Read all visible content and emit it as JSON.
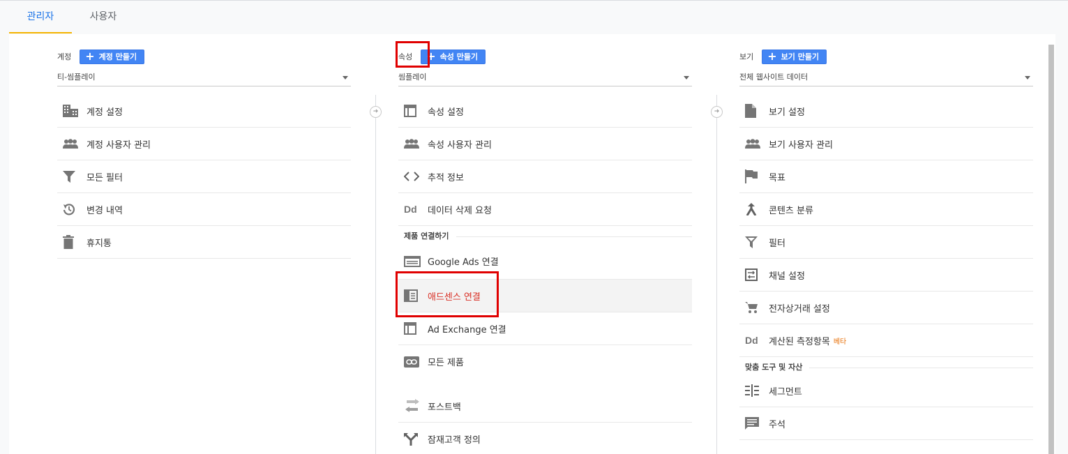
{
  "tabs": [
    {
      "label": "관리자",
      "active": true
    },
    {
      "label": "사용자",
      "active": false
    }
  ],
  "columns": {
    "account": {
      "header": "계정",
      "create_label": "계정 만들기",
      "selected": "티-씸플레이",
      "items": [
        {
          "label": "계정 설정",
          "icon": "building-icon"
        },
        {
          "label": "계정 사용자 관리",
          "icon": "people-icon"
        },
        {
          "label": "모든 필터",
          "icon": "filter-icon"
        },
        {
          "label": "변경 내역",
          "icon": "history-icon"
        },
        {
          "label": "휴지통",
          "icon": "trash-icon"
        }
      ]
    },
    "property": {
      "header": "속성",
      "create_label": "속성 만들기",
      "selected": "씸플레이",
      "items": [
        {
          "label": "속성 설정",
          "icon": "window-icon"
        },
        {
          "label": "속성 사용자 관리",
          "icon": "people-icon"
        },
        {
          "label": "추적 정보",
          "icon": "code-icon"
        },
        {
          "label": "데이터 삭제 요청",
          "icon": "dd-icon"
        }
      ],
      "section_label": "제품 연결하기",
      "links": [
        {
          "label": "Google Ads 연결",
          "icon": "ads-icon"
        },
        {
          "label": "애드센스 연결",
          "icon": "adsense-icon",
          "selected": true
        },
        {
          "label": "Ad Exchange 연결",
          "icon": "window-icon"
        },
        {
          "label": "모든 제품",
          "icon": "link-icon"
        }
      ],
      "more": [
        {
          "label": "포스트백",
          "icon": "swap-icon"
        },
        {
          "label": "잠재고객 정의",
          "icon": "fork-icon"
        }
      ]
    },
    "view": {
      "header": "보기",
      "create_label": "보기 만들기",
      "selected": "전체 웹사이트 데이터",
      "items": [
        {
          "label": "보기 설정",
          "icon": "file-icon"
        },
        {
          "label": "보기 사용자 관리",
          "icon": "people-icon"
        },
        {
          "label": "목표",
          "icon": "flag-icon"
        },
        {
          "label": "콘텐츠 분류",
          "icon": "merge-icon"
        },
        {
          "label": "필터",
          "icon": "filter-icon"
        },
        {
          "label": "채널 설정",
          "icon": "channel-icon"
        },
        {
          "label": "전자상거래 설정",
          "icon": "cart-icon"
        },
        {
          "label": "계산된 측정항목",
          "icon": "dd-icon",
          "badge": "베타"
        }
      ],
      "section_label": "맞춤 도구 및 자산",
      "tools": [
        {
          "label": "세그먼트",
          "icon": "segment-icon"
        },
        {
          "label": "주석",
          "icon": "comment-icon"
        }
      ]
    }
  },
  "colors": {
    "accent": "#1a73e8",
    "tab_indicator": "#f4b400",
    "button": "#4285f4",
    "highlight_box": "#e00000",
    "selected_text": "#d93025"
  }
}
